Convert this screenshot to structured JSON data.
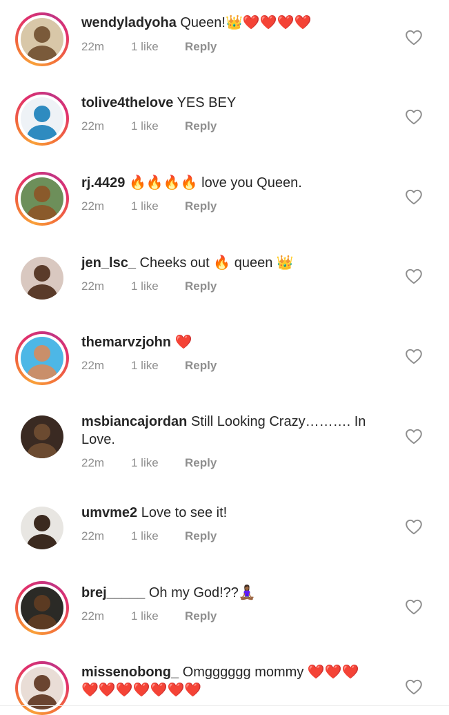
{
  "comments": [
    {
      "user": "wendyladyoha",
      "text": "Queen!👑❤️❤️❤️❤️",
      "time": "22m",
      "likes": "1 like",
      "reply": "Reply",
      "story": true,
      "avatar_color": "#7a5a3a",
      "avatar_bg": "#d8c7a8"
    },
    {
      "user": "tolive4thelove",
      "text": "YES BEY",
      "time": "22m",
      "likes": "1 like",
      "reply": "Reply",
      "story": true,
      "avatar_color": "#2e8bc0",
      "avatar_bg": "#eef2f6"
    },
    {
      "user": "rj.4429",
      "text": "🔥🔥🔥🔥 love you Queen.",
      "time": "22m",
      "likes": "1 like",
      "reply": "Reply",
      "story": true,
      "avatar_color": "#8a5a2b",
      "avatar_bg": "#6d8f5a"
    },
    {
      "user": "jen_lsc_",
      "text": "Cheeks out 🔥 queen 👑",
      "time": "22m",
      "likes": "1 like",
      "reply": "Reply",
      "story": false,
      "avatar_color": "#5a3b2a",
      "avatar_bg": "#d9c8c0"
    },
    {
      "user": "themarvzjohn",
      "text": "❤️",
      "time": "22m",
      "likes": "1 like",
      "reply": "Reply",
      "story": true,
      "avatar_color": "#c98f6a",
      "avatar_bg": "#4db7e6"
    },
    {
      "user": "msbiancajordan",
      "text": "Still Looking Crazy………. In Love.",
      "time": "22m",
      "likes": "1 like",
      "reply": "Reply",
      "story": false,
      "avatar_color": "#6b4a30",
      "avatar_bg": "#3a2a22"
    },
    {
      "user": "umvme2",
      "text": "Love to see it!",
      "time": "22m",
      "likes": "1 like",
      "reply": "Reply",
      "story": false,
      "avatar_color": "#3b2a1f",
      "avatar_bg": "#e8e6e2"
    },
    {
      "user": "brej_____",
      "text": "Oh my God!??🧘🏾‍♀️",
      "time": "22m",
      "likes": "1 like",
      "reply": "Reply",
      "story": true,
      "avatar_color": "#5b3a22",
      "avatar_bg": "#2b2a26"
    },
    {
      "user": "missenobong_",
      "text": "Omgggggg mommy ❤️❤️❤️ ❤️❤️❤️❤️❤️❤️❤️",
      "time": "",
      "likes": "",
      "reply": "",
      "story": true,
      "avatar_color": "#6a4430",
      "avatar_bg": "#e9ddd6"
    }
  ],
  "icons": {
    "like": "heart-outline-icon"
  },
  "colors": {
    "meta_text": "#8e8e8e",
    "username": "#262626",
    "story_ring": "#e1306c"
  }
}
